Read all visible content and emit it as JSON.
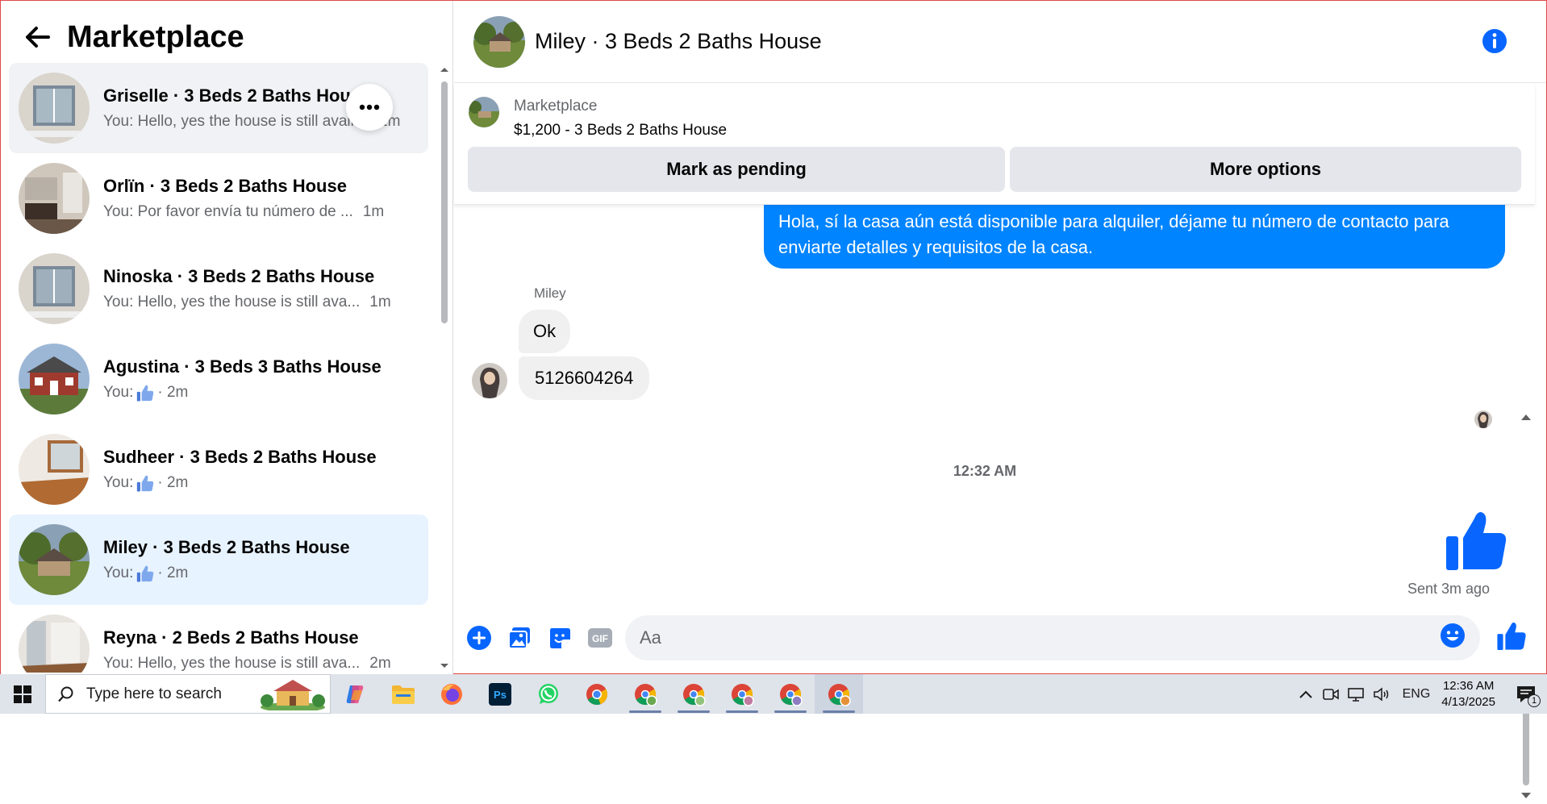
{
  "left": {
    "title": "Marketplace",
    "conversations": [
      {
        "title": "Griselle · 3 Beds 2 Baths House",
        "preview": "You: Hello, yes the house is still available",
        "time": "1m",
        "state": "hover",
        "liked": false
      },
      {
        "title": "Orlïn · 3 Beds 2 Baths House",
        "preview": "You: Por favor envía tu número de ...",
        "time": "1m",
        "state": "",
        "liked": false
      },
      {
        "title": "Ninoska · 3 Beds 2 Baths House",
        "preview": "You: Hello, yes the house is still ava...",
        "time": "1m",
        "state": "",
        "liked": false
      },
      {
        "title": "Agustina · 3 Beds 3 Baths House",
        "preview": "You:",
        "time": "· 2m",
        "state": "",
        "liked": true
      },
      {
        "title": "Sudheer · 3 Beds 2 Baths House",
        "preview": "You:",
        "time": "· 2m",
        "state": "",
        "liked": true
      },
      {
        "title": "Miley · 3 Beds 2 Baths House",
        "preview": "You:",
        "time": "· 2m",
        "state": "active",
        "liked": true
      },
      {
        "title": "Reyna · 2 Beds 2 Baths House",
        "preview": "You: Hello, yes the house is still ava...",
        "time": "2m",
        "state": "",
        "liked": false
      }
    ]
  },
  "chat": {
    "title": "Miley · 3 Beds 2 Baths House",
    "listing_category": "Marketplace",
    "listing_price": "$1,200 - 3 Beds 2 Baths House",
    "mark_pending": "Mark as pending",
    "more_options": "More options",
    "outgoing_message": "Hola, sí la casa aún está disponible para alquiler, déjame tu número de contacto para enviarte detalles y requisitos de la casa.",
    "sender_name": "Miley",
    "incoming_1": "Ok",
    "incoming_2": "5126604264",
    "timestamp": "12:32 AM",
    "sent_status": "Sent 3m ago",
    "input_placeholder": "Aa",
    "gif_label": "GIF"
  },
  "taskbar": {
    "search_placeholder": "Type here to search",
    "language": "ENG",
    "time": "12:36 AM",
    "date": "4/13/2025",
    "notification_count": "1"
  },
  "colors": {
    "accent": "#0084ff",
    "messenger_blue": "#0866ff"
  }
}
